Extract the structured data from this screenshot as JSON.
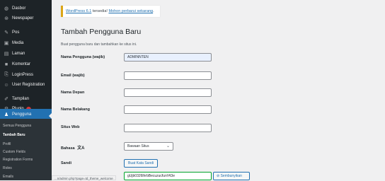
{
  "sidebar": {
    "items": [
      {
        "label": "Dasbor",
        "icon": "dashboard-icon"
      },
      {
        "label": "Newspaper",
        "icon": "newspaper-icon"
      },
      {
        "label": "Pos",
        "icon": "pin-icon"
      },
      {
        "label": "Media",
        "icon": "media-icon"
      },
      {
        "label": "Laman",
        "icon": "page-icon"
      },
      {
        "label": "Komentar",
        "icon": "comment-icon"
      },
      {
        "label": "LoginPress",
        "icon": "loginpress-icon"
      },
      {
        "label": "User Registration",
        "icon": "user-registration-icon"
      },
      {
        "label": "Tampilan",
        "icon": "brush-icon"
      },
      {
        "label": "Plugin",
        "icon": "plugin-icon",
        "badge": true
      },
      {
        "label": "Pengguna",
        "icon": "users-icon",
        "active": true
      }
    ],
    "submenu": [
      {
        "label": "Semua Pengguna"
      },
      {
        "label": "Tambah Baru",
        "current": true
      },
      {
        "label": "Profil"
      },
      {
        "label": "Custom Fields"
      },
      {
        "label": "Registration Forms"
      },
      {
        "label": "Roles"
      },
      {
        "label": "Emails"
      }
    ]
  },
  "notice": {
    "link1": "WordPress 6.1",
    "middle": " tersedia! ",
    "link2": "Mohon perbarui sekarang",
    "end": "."
  },
  "page": {
    "title": "Tambah Pengguna Baru",
    "description": "Buat pengguna baru dan tambahkan ke situs ini."
  },
  "form": {
    "username": {
      "label": "Nama Pengguna (wajib)",
      "value": "ADMINNTEN"
    },
    "email": {
      "label": "Email (wajib)",
      "value": ""
    },
    "first_name": {
      "label": "Nama Depan",
      "value": ""
    },
    "last_name": {
      "label": "Nama Belakang",
      "value": ""
    },
    "website": {
      "label": "Situs Web",
      "value": ""
    },
    "language": {
      "label": "Bahasa",
      "selected": "Bawaan Situs"
    },
    "password": {
      "label": "Sandi",
      "generate_button": "Buat Kata Sandi",
      "value": "gUjb0326lhrbBecuzucfun!#t3e",
      "hide_button": "Sembunyikan"
    }
  },
  "status_bar": {
    "url": "...n/admin.php?page=td_theme_welcome"
  },
  "colors": {
    "sidebar": "#1d2327",
    "accent": "#2271b1",
    "notice": "#dba617",
    "valid": "#00a32a"
  }
}
